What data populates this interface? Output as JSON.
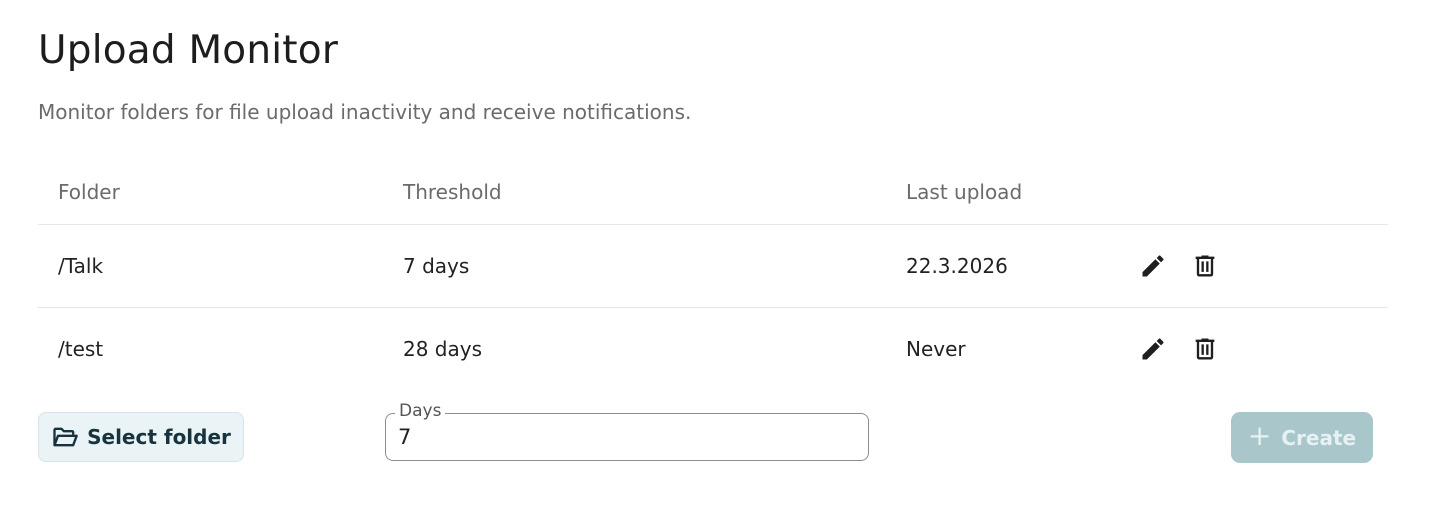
{
  "page": {
    "title": "Upload Monitor",
    "subtitle": "Monitor folders for file upload inactivity and receive notifications."
  },
  "table": {
    "columns": {
      "folder": "Folder",
      "threshold": "Threshold",
      "last_upload": "Last upload"
    },
    "rows": [
      {
        "folder": "/Talk",
        "threshold": "7 days",
        "last_upload": "22.3.2026"
      },
      {
        "folder": "/test",
        "threshold": "28 days",
        "last_upload": "Never"
      }
    ],
    "row_actions": {
      "edit_icon": "pencil-icon",
      "delete_icon": "trash-icon"
    }
  },
  "form": {
    "select_folder_label": "Select folder",
    "select_folder_icon": "folder-open-icon",
    "days_label": "Days",
    "days_value": "7",
    "create_label": "Create",
    "create_icon": "plus-icon",
    "create_disabled": true
  },
  "colors": {
    "select_button_bg": "#eaf3f5",
    "create_button_bg": "#a9c7cb",
    "text_muted": "#6b6b6b"
  }
}
